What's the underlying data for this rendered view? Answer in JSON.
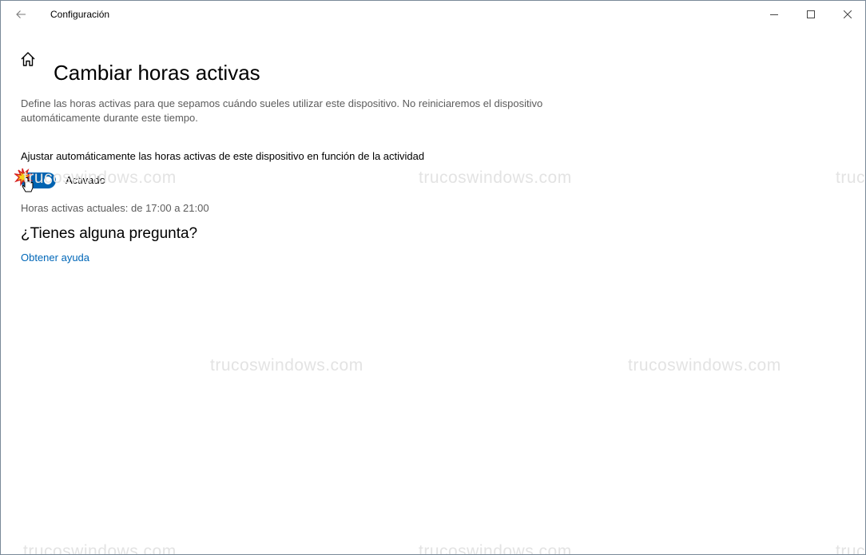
{
  "titlebar": {
    "title": "Configuración",
    "back_icon": "back-arrow-icon",
    "minimize_icon": "minimize-icon",
    "maximize_icon": "maximize-icon",
    "close_icon": "close-icon"
  },
  "page": {
    "home_icon": "home-icon",
    "title": "Cambiar horas activas",
    "description": "Define las horas activas para que sepamos cuándo sueles utilizar este dispositivo. No reiniciaremos el dispositivo automáticamente durante este tiempo."
  },
  "auto_adjust": {
    "label": "Ajustar automáticamente las horas activas de este dispositivo en función de la actividad",
    "toggle_state": "Activado",
    "toggle_on": true,
    "toggle_color": "#0063b1"
  },
  "current_hours": "Horas activas actuales: de 17:00 a 21:00",
  "help": {
    "heading": "¿Tienes alguna pregunta?",
    "link": "Obtener ayuda",
    "link_color": "#0067b8"
  },
  "watermark": "trucoswindows.com"
}
